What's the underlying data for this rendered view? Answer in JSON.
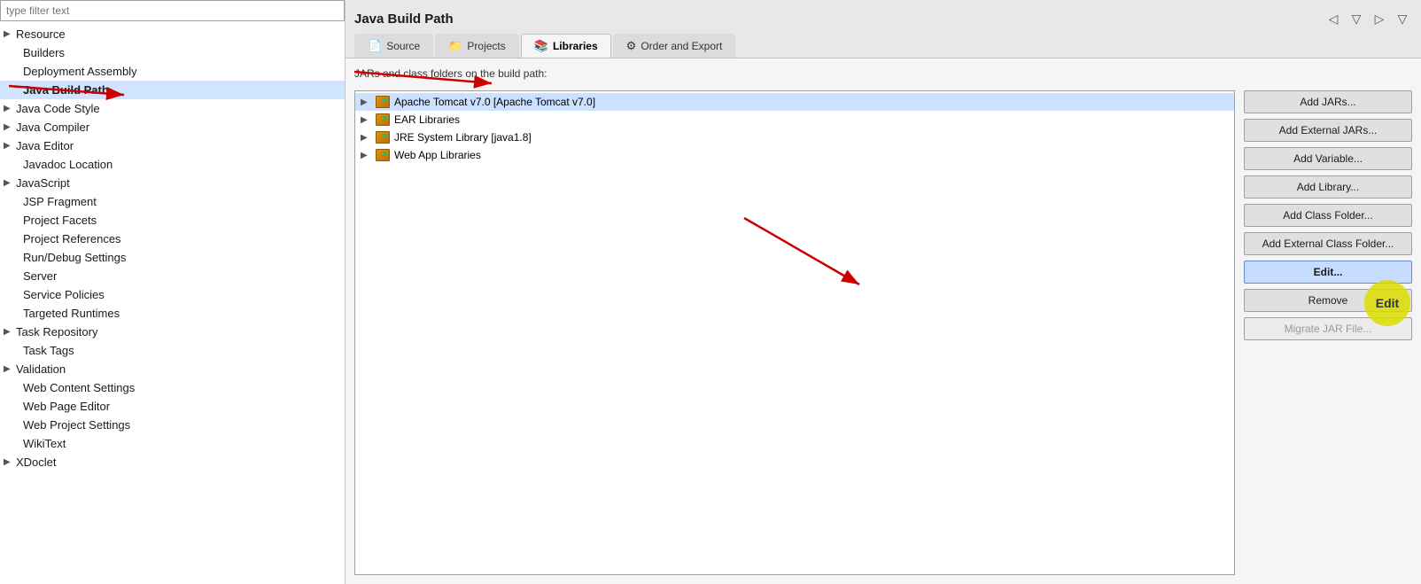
{
  "sidebar": {
    "filter_placeholder": "type filter text",
    "items": [
      {
        "label": "Resource",
        "hasArrow": true,
        "active": false,
        "id": "resource"
      },
      {
        "label": "Builders",
        "hasArrow": false,
        "active": false,
        "id": "builders"
      },
      {
        "label": "Deployment Assembly",
        "hasArrow": false,
        "active": false,
        "id": "deployment-assembly"
      },
      {
        "label": "Java Build Path",
        "hasArrow": false,
        "active": true,
        "id": "java-build-path"
      },
      {
        "label": "Java Code Style",
        "hasArrow": true,
        "active": false,
        "id": "java-code-style"
      },
      {
        "label": "Java Compiler",
        "hasArrow": true,
        "active": false,
        "id": "java-compiler"
      },
      {
        "label": "Java Editor",
        "hasArrow": true,
        "active": false,
        "id": "java-editor"
      },
      {
        "label": "Javadoc Location",
        "hasArrow": false,
        "active": false,
        "id": "javadoc-location"
      },
      {
        "label": "JavaScript",
        "hasArrow": true,
        "active": false,
        "id": "javascript"
      },
      {
        "label": "JSP Fragment",
        "hasArrow": false,
        "active": false,
        "id": "jsp-fragment"
      },
      {
        "label": "Project Facets",
        "hasArrow": false,
        "active": false,
        "id": "project-facets"
      },
      {
        "label": "Project References",
        "hasArrow": false,
        "active": false,
        "id": "project-references"
      },
      {
        "label": "Run/Debug Settings",
        "hasArrow": false,
        "active": false,
        "id": "run-debug-settings"
      },
      {
        "label": "Server",
        "hasArrow": false,
        "active": false,
        "id": "server"
      },
      {
        "label": "Service Policies",
        "hasArrow": false,
        "active": false,
        "id": "service-policies"
      },
      {
        "label": "Targeted Runtimes",
        "hasArrow": false,
        "active": false,
        "id": "targeted-runtimes"
      },
      {
        "label": "Task Repository",
        "hasArrow": true,
        "active": false,
        "id": "task-repository"
      },
      {
        "label": "Task Tags",
        "hasArrow": false,
        "active": false,
        "id": "task-tags"
      },
      {
        "label": "Validation",
        "hasArrow": true,
        "active": false,
        "id": "validation"
      },
      {
        "label": "Web Content Settings",
        "hasArrow": false,
        "active": false,
        "id": "web-content-settings"
      },
      {
        "label": "Web Page Editor",
        "hasArrow": false,
        "active": false,
        "id": "web-page-editor"
      },
      {
        "label": "Web Project Settings",
        "hasArrow": false,
        "active": false,
        "id": "web-project-settings"
      },
      {
        "label": "WikiText",
        "hasArrow": false,
        "active": false,
        "id": "wikitext"
      },
      {
        "label": "XDoclet",
        "hasArrow": true,
        "active": false,
        "id": "xdoclet"
      }
    ]
  },
  "main": {
    "title": "Java Build Path",
    "jars_label": "JARs and class folders on the build path:",
    "tabs": [
      {
        "label": "Source",
        "icon": "📄",
        "active": false,
        "id": "source"
      },
      {
        "label": "Projects",
        "icon": "📁",
        "active": false,
        "id": "projects"
      },
      {
        "label": "Libraries",
        "icon": "📚",
        "active": true,
        "id": "libraries"
      },
      {
        "label": "Order and Export",
        "icon": "⚙",
        "active": false,
        "id": "order-export"
      }
    ],
    "libraries": [
      {
        "label": "Apache Tomcat v7.0 [Apache Tomcat v7.0]",
        "selected": true,
        "expanded": false,
        "id": "tomcat"
      },
      {
        "label": "EAR Libraries",
        "selected": false,
        "expanded": false,
        "id": "ear-libs"
      },
      {
        "label": "JRE System Library [java1.8]",
        "selected": false,
        "expanded": false,
        "id": "jre-system"
      },
      {
        "label": "Web App Libraries",
        "selected": false,
        "expanded": false,
        "id": "web-app-libs"
      }
    ],
    "buttons": [
      {
        "label": "Add JARs...",
        "id": "add-jars",
        "disabled": false,
        "highlighted": false
      },
      {
        "label": "Add External JARs...",
        "id": "add-external-jars",
        "disabled": false,
        "highlighted": false
      },
      {
        "label": "Add Variable...",
        "id": "add-variable",
        "disabled": false,
        "highlighted": false
      },
      {
        "label": "Add Library...",
        "id": "add-library",
        "disabled": false,
        "highlighted": false
      },
      {
        "label": "Add Class Folder...",
        "id": "add-class-folder",
        "disabled": false,
        "highlighted": false
      },
      {
        "label": "Add External Class Folder...",
        "id": "add-external-class-folder",
        "disabled": false,
        "highlighted": false
      },
      {
        "label": "Edit...",
        "id": "edit",
        "disabled": false,
        "highlighted": true
      },
      {
        "label": "Remove",
        "id": "remove",
        "disabled": false,
        "highlighted": false
      },
      {
        "label": "Migrate JAR File...",
        "id": "migrate-jar",
        "disabled": true,
        "highlighted": false
      }
    ]
  }
}
